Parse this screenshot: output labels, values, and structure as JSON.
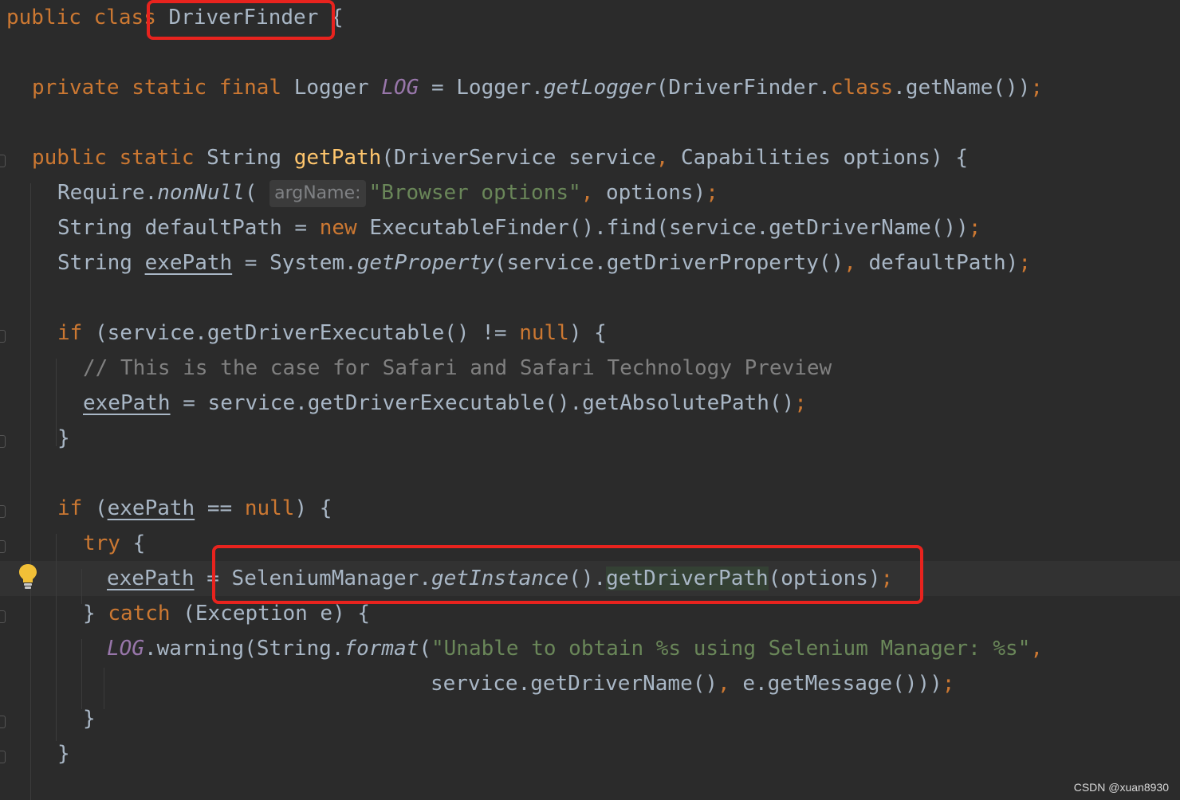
{
  "code": {
    "l1": {
      "public": "public",
      "class": "class",
      "name": "DriverFinder",
      "brace": " {"
    },
    "l2": {
      "private": "private",
      "static": "static",
      "final": "final",
      "type": "Logger",
      "field": "LOG",
      "eq": " = ",
      "logger": "Logger.",
      "getLogger": "getLogger",
      "arg": "(DriverFinder.",
      "classkw": "class",
      "rest": ".getName())",
      "semi": ";"
    },
    "l3": {
      "public": "public",
      "static": "static",
      "type": "String",
      "method": "getPath",
      "p1": "(DriverService service",
      "comma": ",",
      "p2": " Capabilities options) {"
    },
    "l4": {
      "require": "Require.",
      "nonNull": "nonNull",
      "paren": "(",
      "hint": "argName:",
      "str": "\"Browser options\"",
      "comma": ",",
      "rest": " options)",
      "semi": ";"
    },
    "l5": {
      "a": "String defaultPath = ",
      "new": "new",
      "b": " ExecutableFinder().find(service.getDriverName())",
      "semi": ";"
    },
    "l6": {
      "a": "String ",
      "var": "exePath",
      "b": " = System.",
      "getProperty": "getProperty",
      "c": "(service.getDriverProperty()",
      "comma": ",",
      "d": " defaultPath)",
      "semi": ";"
    },
    "l7": {
      "if": "if",
      "a": " (service.getDriverExecutable() != ",
      "null": "null",
      "b": ") {"
    },
    "l8": {
      "comment": "// This is the case for Safari and Safari Technology Preview"
    },
    "l9": {
      "var": "exePath",
      "a": " = service.getDriverExecutable().getAbsolutePath()",
      "semi": ";"
    },
    "l10": {
      "brace": "}"
    },
    "l11": {
      "if": "if",
      "a": " (",
      "var": "exePath",
      "b": " == ",
      "null": "null",
      "c": ") {"
    },
    "l12": {
      "try": "try",
      "a": " {"
    },
    "l13": {
      "var": "exePath",
      "a": " = ",
      "b": "SeleniumManager.",
      "getInstance": "getInstance",
      "c": "().",
      "getDriverPath": "getDriverPath",
      "d": "(options)",
      "semi": ";"
    },
    "l14": {
      "a": "} ",
      "catch": "catch",
      "b": " (Exception e) {"
    },
    "l15": {
      "log": "LOG",
      "a": ".warning(String.",
      "format": "format",
      "b": "(",
      "str": "\"Unable to obtain %s using Selenium Manager: %s\"",
      "comma": ","
    },
    "l16": {
      "a": "service.getDriverName()",
      "comma": ",",
      "b": " e.getMessage()))",
      "semi": ";"
    },
    "l17": {
      "brace": "}"
    },
    "l18": {
      "brace": "}"
    }
  },
  "watermark": "CSDN @xuan8930",
  "colors": {
    "keyword": "#cc7832",
    "string": "#6a8759",
    "comment": "#808080",
    "method_decl": "#ffc66d",
    "static_field": "#9876aa",
    "text": "#a9b7c6",
    "annotation_box": "#e8231e"
  }
}
